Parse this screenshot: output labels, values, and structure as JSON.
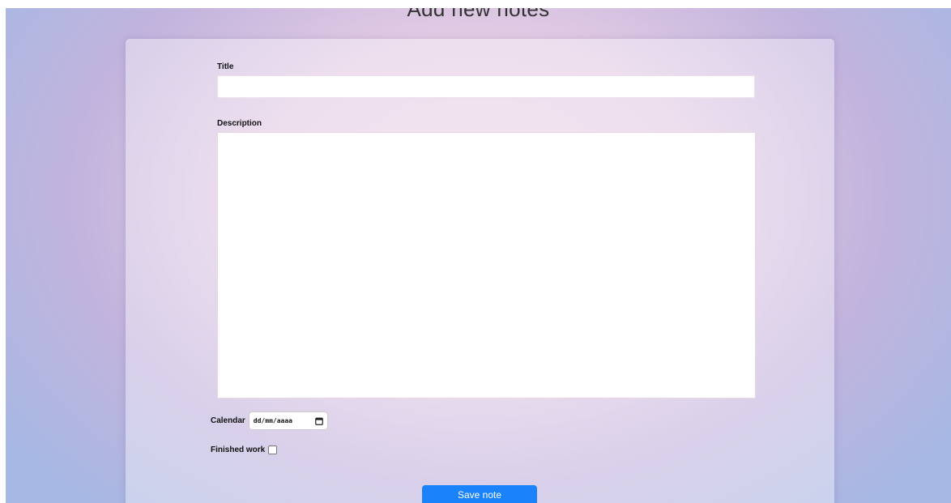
{
  "page": {
    "title": "Add new notes"
  },
  "form": {
    "title_label": "Title",
    "title_value": "",
    "description_label": "Description",
    "description_value": "",
    "calendar_label": "Calendar",
    "calendar_placeholder": "dd/mm/aaaa",
    "calendar_icon": "calendar-icon",
    "finished_label": "Finished work",
    "finished_checked": false,
    "save_label": "Save note"
  },
  "colors": {
    "save_button": "#1a82fa",
    "background_center": "#eed6e9",
    "background_edge": "#a6b8e4"
  }
}
